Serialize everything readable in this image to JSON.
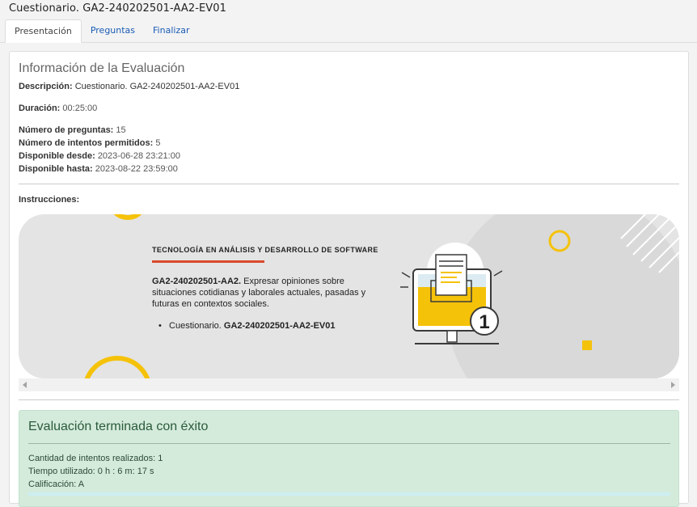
{
  "header": {
    "title": "Cuestionario. GA2-240202501-AA2-EV01",
    "tabs": [
      {
        "label": "Presentación",
        "active": true
      },
      {
        "label": "Preguntas",
        "active": false
      },
      {
        "label": "Finalizar",
        "active": false
      }
    ]
  },
  "info": {
    "heading": "Información de la Evaluación",
    "descripcion_label": "Descripción:",
    "descripcion_value": "Cuestionario. GA2-240202501-AA2-EV01",
    "duracion_label": "Duración:",
    "duracion_value": "00:25:00",
    "preguntas_label": "Número de preguntas:",
    "preguntas_value": "15",
    "intentos_label": "Número de intentos permitidos:",
    "intentos_value": "5",
    "desde_label": "Disponible desde:",
    "desde_value": "2023-06-28 23:21:00",
    "hasta_label": "Disponible hasta:",
    "hasta_value": "2023-08-22 23:59:00",
    "instrucciones_label": "Instrucciones:"
  },
  "banner": {
    "course": "TECNOLOGÍA EN ANÁLISIS Y DESARROLLO DE SOFTWARE",
    "activity_code": "GA2-240202501-AA2.",
    "activity_text": " Expresar opiniones sobre situaciones cotidianas y laborales actuales, pasadas y futuras en contextos sociales.",
    "bullet_prefix": "Cuestionario. ",
    "bullet_code": "GA2-240202501-AA2-EV01",
    "badge_number": "1",
    "colors": {
      "accent_yellow": "#f5c20a",
      "red_line": "#d94a2b",
      "banner_bg": "#e4e4e4"
    }
  },
  "result": {
    "title": "Evaluación terminada con éxito",
    "intentos": "Cantidad de intentos realizados: 1",
    "tiempo": "Tiempo utilizado: 0 h : 6 m: 17 s",
    "calificacion": "Calificación: A"
  }
}
